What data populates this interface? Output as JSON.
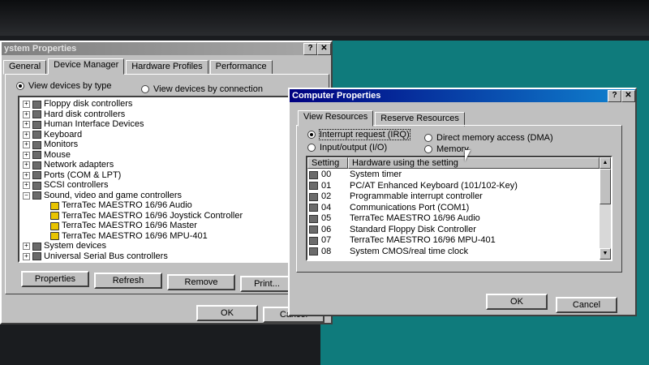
{
  "system_window": {
    "title": "ystem Properties",
    "tabs": [
      "General",
      "Device Manager",
      "Hardware Profiles",
      "Performance"
    ],
    "selected_tab": "Device Manager",
    "view_by_type": "View devices by type",
    "view_by_connection": "View devices by connection",
    "tree": [
      {
        "label": "Floppy disk controllers",
        "expanded": false,
        "child": false
      },
      {
        "label": "Hard disk controllers",
        "expanded": false,
        "child": false
      },
      {
        "label": "Human Interface Devices",
        "expanded": false,
        "child": false
      },
      {
        "label": "Keyboard",
        "expanded": false,
        "child": false
      },
      {
        "label": "Monitors",
        "expanded": false,
        "child": false
      },
      {
        "label": "Mouse",
        "expanded": false,
        "child": false
      },
      {
        "label": "Network adapters",
        "expanded": false,
        "child": false
      },
      {
        "label": "Ports (COM & LPT)",
        "expanded": false,
        "child": false
      },
      {
        "label": "SCSI controllers",
        "expanded": false,
        "child": false
      },
      {
        "label": "Sound, video and game controllers",
        "expanded": true,
        "child": false
      },
      {
        "label": "TerraTec MAESTRO 16/96 Audio",
        "expanded": false,
        "child": true
      },
      {
        "label": "TerraTec MAESTRO 16/96 Joystick Controller",
        "expanded": false,
        "child": true
      },
      {
        "label": "TerraTec MAESTRO 16/96 Master",
        "expanded": false,
        "child": true
      },
      {
        "label": "TerraTec MAESTRO 16/96 MPU-401",
        "expanded": false,
        "child": true
      },
      {
        "label": "System devices",
        "expanded": false,
        "child": false
      },
      {
        "label": "Universal Serial Bus controllers",
        "expanded": false,
        "child": false
      }
    ],
    "buttons": {
      "properties": "Properties",
      "refresh": "Refresh",
      "remove": "Remove",
      "print": "Print..."
    },
    "ok": "OK",
    "cancel": "Cancel"
  },
  "computer_window": {
    "title": "Computer Properties",
    "tabs": [
      "View Resources",
      "Reserve Resources"
    ],
    "radios": {
      "irq": "Interrupt request (IRQ)",
      "io": "Input/output (I/O)",
      "dma": "Direct memory access (DMA)",
      "memory": "Memory"
    },
    "columns": [
      "Setting",
      "Hardware using the setting"
    ],
    "rows": [
      {
        "setting": "00",
        "hardware": "System timer"
      },
      {
        "setting": "01",
        "hardware": "PC/AT Enhanced Keyboard (101/102-Key)"
      },
      {
        "setting": "02",
        "hardware": "Programmable interrupt controller"
      },
      {
        "setting": "04",
        "hardware": "Communications Port (COM1)"
      },
      {
        "setting": "05",
        "hardware": "TerraTec MAESTRO 16/96 Audio"
      },
      {
        "setting": "06",
        "hardware": "Standard Floppy Disk Controller"
      },
      {
        "setting": "07",
        "hardware": "TerraTec MAESTRO 16/96 MPU-401"
      },
      {
        "setting": "08",
        "hardware": "System CMOS/real time clock"
      }
    ],
    "ok": "OK",
    "cancel": "Cancel"
  },
  "colors": {
    "desktop": "#0f7b7c",
    "title_active": "#000080",
    "face": "#c0c0c0"
  }
}
